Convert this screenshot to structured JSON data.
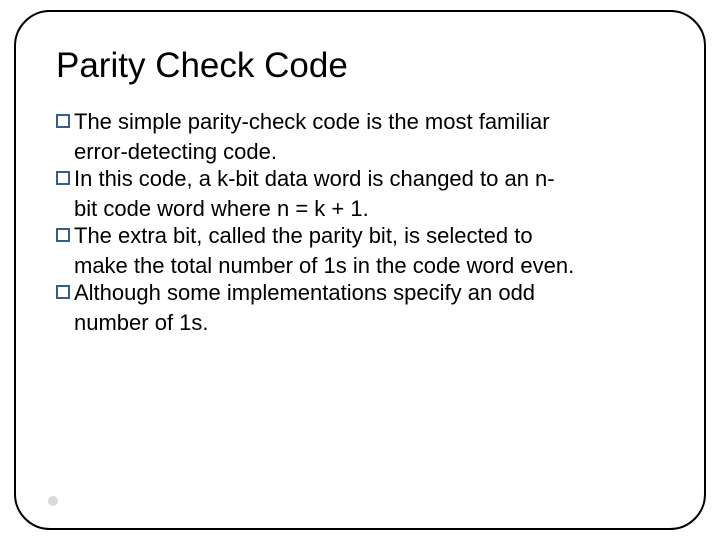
{
  "slide": {
    "title": "Parity Check Code",
    "bullets": [
      {
        "lead": "The simple parity-check code is the most familiar",
        "cont": "error-detecting code."
      },
      {
        "lead": "In this code, a k-bit data word is changed to an n-",
        "cont": "bit code word where n = k + 1."
      },
      {
        "lead": "The extra bit, called the parity bit, is selected to",
        "cont": "make the total number of 1s in the code word even."
      },
      {
        "lead": "Although some implementations specify an odd",
        "cont": "number of 1s."
      }
    ]
  }
}
